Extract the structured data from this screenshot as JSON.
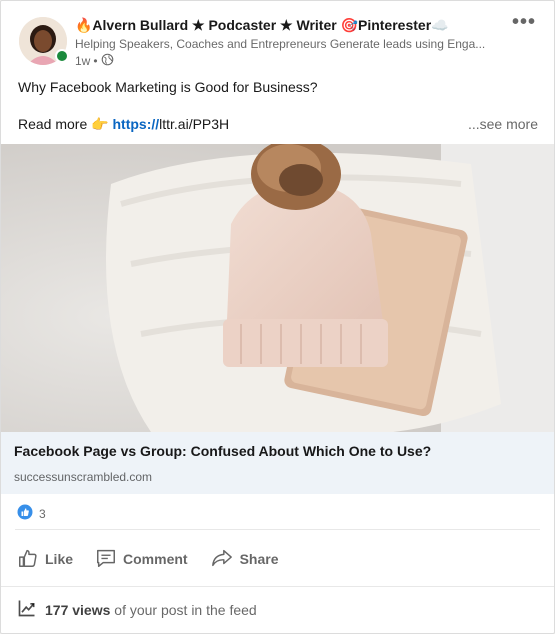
{
  "post": {
    "author_name": "🔥Alvern Bullard ★ Podcaster ★ Writer 🎯Pinterester☁️",
    "headline": "Helping Speakers, Coaches and Entrepreneurs Generate leads using Enga...",
    "time": "1w",
    "separator": "•",
    "menu_label": "•••",
    "text_line1": "Why Facebook Marketing is Good for Business?",
    "read_more_prefix": "Read more",
    "pointing_emoji": "👉",
    "link_scheme": "https://",
    "link_rest": "lttr.ai/PP3H",
    "see_more_label": "...see more"
  },
  "article": {
    "title": "Facebook Page vs Group: Confused About Which One to Use?",
    "domain": "successunscrambled.com"
  },
  "social": {
    "reaction_count": "3"
  },
  "actions": {
    "like_label": "Like",
    "comment_label": "Comment",
    "share_label": "Share"
  },
  "views": {
    "count_text": "177 views",
    "suffix_text": "of your post in the feed"
  },
  "colors": {
    "link": "#0a66c2",
    "presence": "#1b8a3c",
    "article_bg": "#eef3f8"
  },
  "icons": [
    "globe-icon",
    "like-icon",
    "comment-icon",
    "share-icon",
    "analytics-icon",
    "like-reaction-icon",
    "overflow-menu-icon"
  ]
}
